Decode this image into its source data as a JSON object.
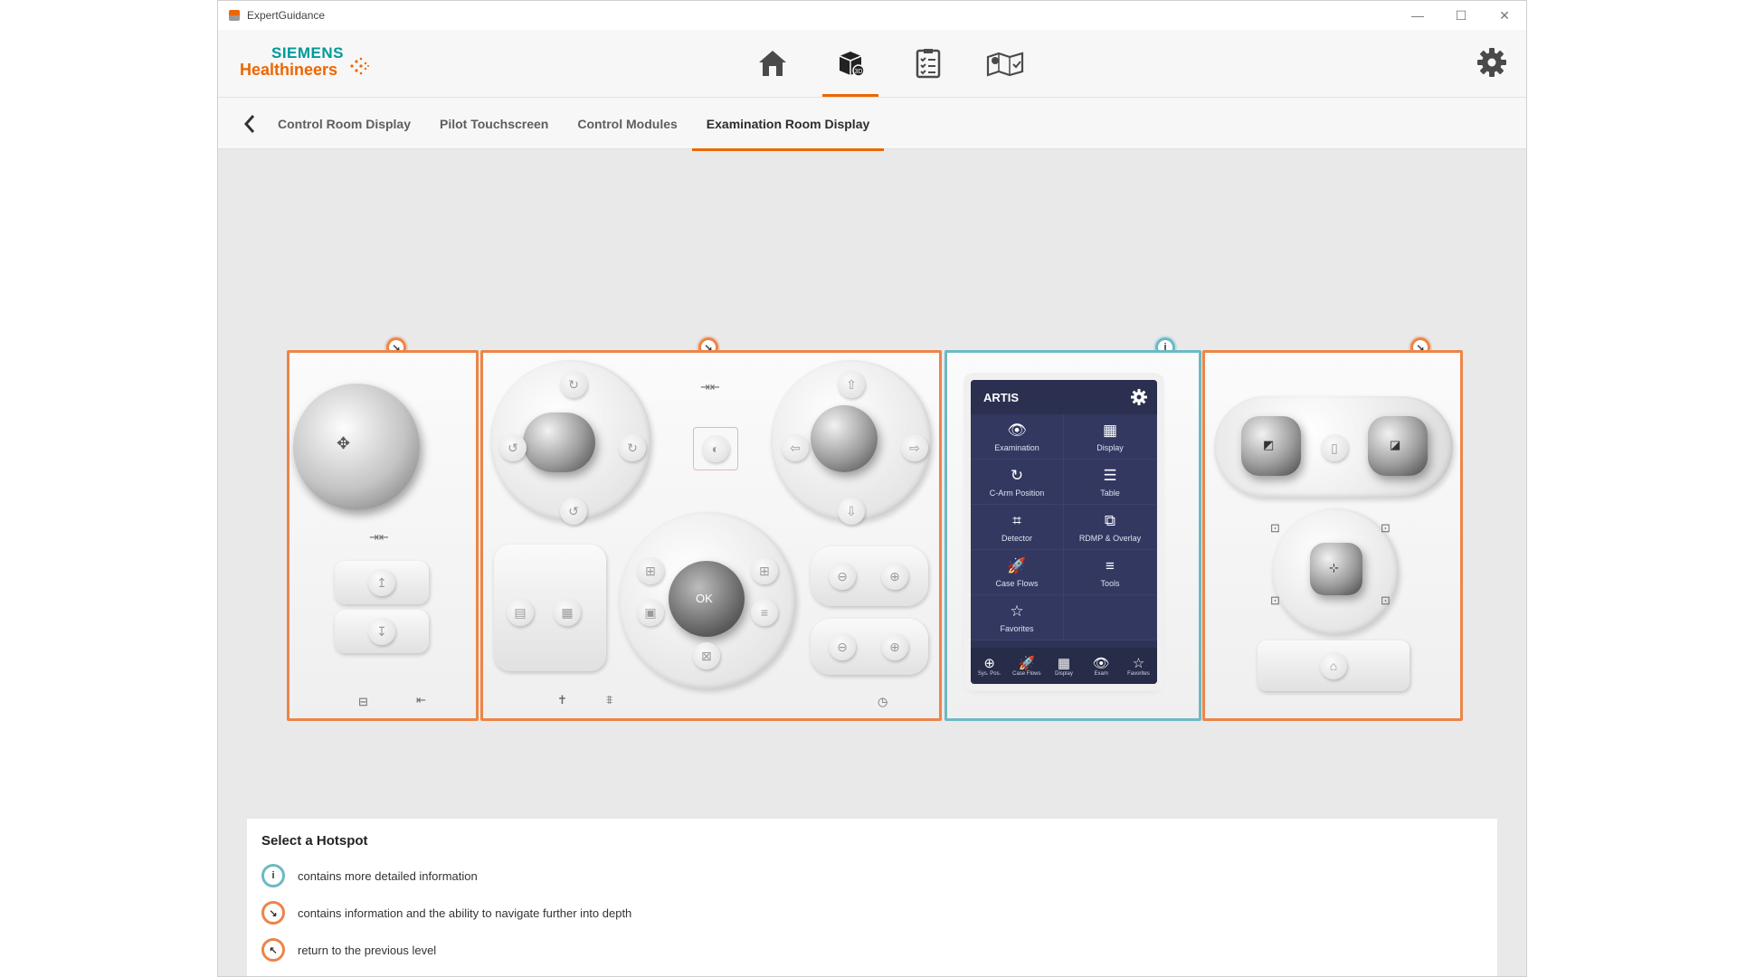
{
  "window": {
    "title": "ExpertGuidance",
    "controls": [
      "—",
      "☐",
      "✕"
    ]
  },
  "brand": {
    "line1": "SIEMENS",
    "line2": "Healthineers",
    "accent": "#ec6602",
    "teal": "#009999"
  },
  "nav": {
    "items": [
      {
        "name": "home-icon",
        "active": false
      },
      {
        "name": "3d-box-icon",
        "active": true
      },
      {
        "name": "checklist-icon",
        "active": false
      },
      {
        "name": "map-icon",
        "active": false
      }
    ]
  },
  "tabs": [
    "Control Room Display",
    "Pilot Touchscreen",
    "Control Modules",
    "Examination Room Display"
  ],
  "active_tab": 3,
  "hotspots": [
    {
      "type": "navigate",
      "symbol": "↘"
    },
    {
      "type": "navigate",
      "symbol": "↘"
    },
    {
      "type": "info",
      "symbol": "i"
    },
    {
      "type": "navigate",
      "symbol": "↘"
    }
  ],
  "touchscreen": {
    "title": "ARTIS",
    "tiles": [
      {
        "icon": "👁",
        "label": "Examination"
      },
      {
        "icon": "▦",
        "label": "Display"
      },
      {
        "icon": "↻",
        "label": "C-Arm Position"
      },
      {
        "icon": "☰",
        "label": "Table"
      },
      {
        "icon": "⌗",
        "label": "Detector"
      },
      {
        "icon": "⧉",
        "label": "RDMP & Overlay"
      },
      {
        "icon": "🚀",
        "label": "Case Flows"
      },
      {
        "icon": "≡",
        "label": "Tools"
      },
      {
        "icon": "☆",
        "label": "Favorites"
      },
      {
        "icon": "",
        "label": ""
      }
    ],
    "footer": [
      {
        "icon": "⊕",
        "label": "Sys. Pos."
      },
      {
        "icon": "🚀",
        "label": "Case Flows"
      },
      {
        "icon": "▦",
        "label": "Display"
      },
      {
        "icon": "👁",
        "label": "Exam"
      },
      {
        "icon": "☆",
        "label": "Favorites"
      }
    ]
  },
  "ok_label": "OK",
  "legend": {
    "title": "Select a Hotspot",
    "items": [
      {
        "symbol": "i",
        "kind": "info",
        "text": "contains more detailed information"
      },
      {
        "symbol": "↘",
        "kind": "navigate",
        "text": "contains information and the ability to navigate further into depth"
      },
      {
        "symbol": "↖",
        "kind": "back",
        "text": "return to the previous level"
      }
    ]
  }
}
